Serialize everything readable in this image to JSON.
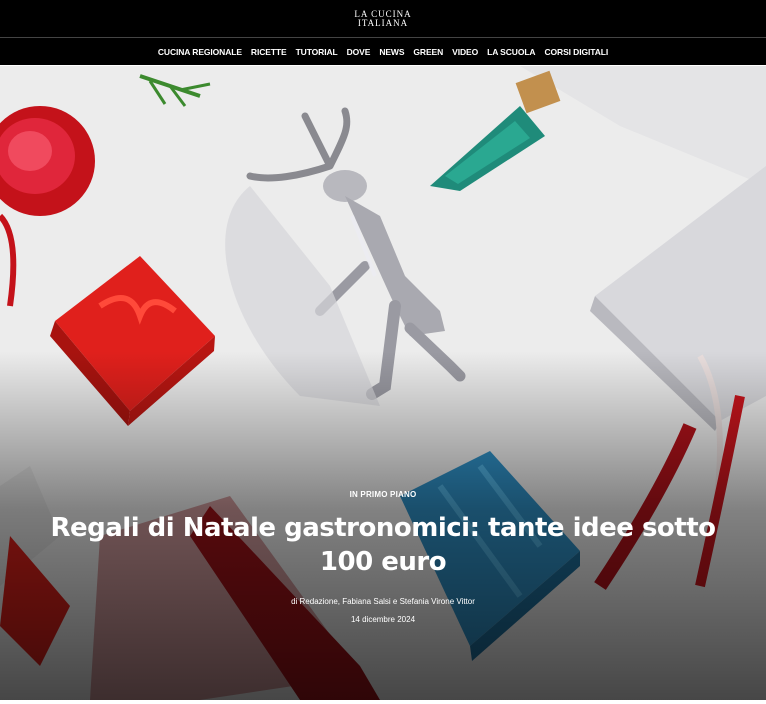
{
  "header": {
    "logo_line1": "LA CUCINA",
    "logo_line2": "ITALIANA"
  },
  "nav": {
    "items": [
      "CUCINA REGIONALE",
      "RICETTE",
      "TUTORIAL",
      "DOVE",
      "NEWS",
      "GREEN",
      "VIDEO",
      "LA SCUOLA",
      "CORSI DIGITALI"
    ]
  },
  "hero": {
    "image_icon": "christmas-gifts-photo",
    "kicker": "IN PRIMO PIANO",
    "headline": "Regali di Natale gastronomici: tante idee sotto 100 euro",
    "byline": "di Redazione, Fabiana Salsi e Stefania Virone Vittor",
    "date": "14 dicembre 2024"
  },
  "colors": {
    "topbar_bg": "#000000",
    "nav_text": "#ffffff",
    "gift_red": "#d9201a",
    "gift_blue": "#2f8fc4",
    "gift_silver": "#d8d8dc",
    "ribbon_green": "#1f8b7a"
  }
}
